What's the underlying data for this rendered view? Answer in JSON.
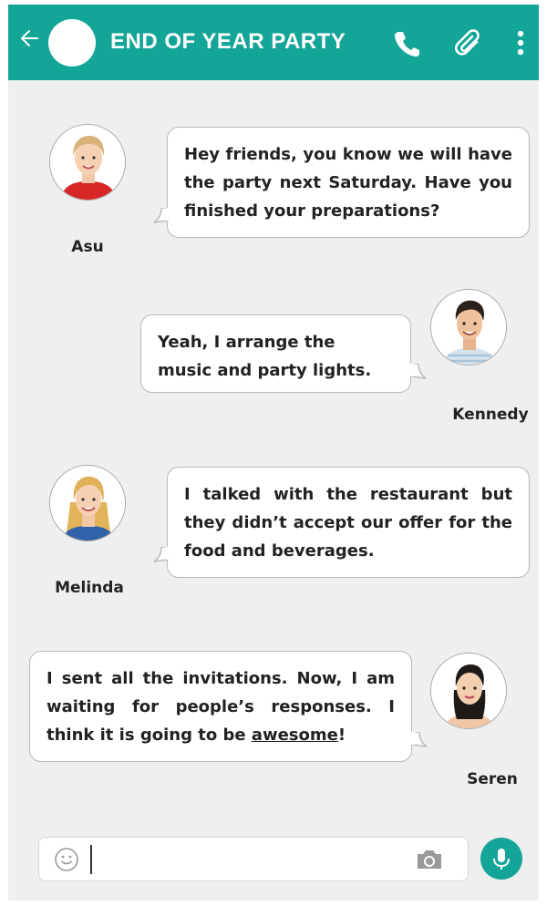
{
  "header": {
    "title": "END OF YEAR PARTY",
    "back_icon": "arrow-left-icon",
    "call_icon": "phone-icon",
    "attach_icon": "paperclip-icon",
    "menu_icon": "more-vertical-icon",
    "bg_color": "#13a597"
  },
  "messages": [
    {
      "sender": "Asu",
      "side": "left",
      "text": "Hey friends, you know we will have the party next Saturday. Have you finished your preparations?"
    },
    {
      "sender": "Kennedy",
      "side": "right",
      "text": "Yeah, I arrange the music and party lights."
    },
    {
      "sender": "Melinda",
      "side": "left",
      "text": "I talked with the restaurant but they didn’t accept our offer for the food and beverages."
    },
    {
      "sender": "Seren",
      "side": "right",
      "text_before": "I sent all the invitations. Now, I am waiting for people’s responses. I think it is going to be ",
      "text_underlined": "awesome",
      "text_after": "!"
    }
  ],
  "composer": {
    "emoji_icon": "smiley-icon",
    "camera_icon": "camera-icon",
    "mic_icon": "microphone-icon",
    "value": ""
  }
}
